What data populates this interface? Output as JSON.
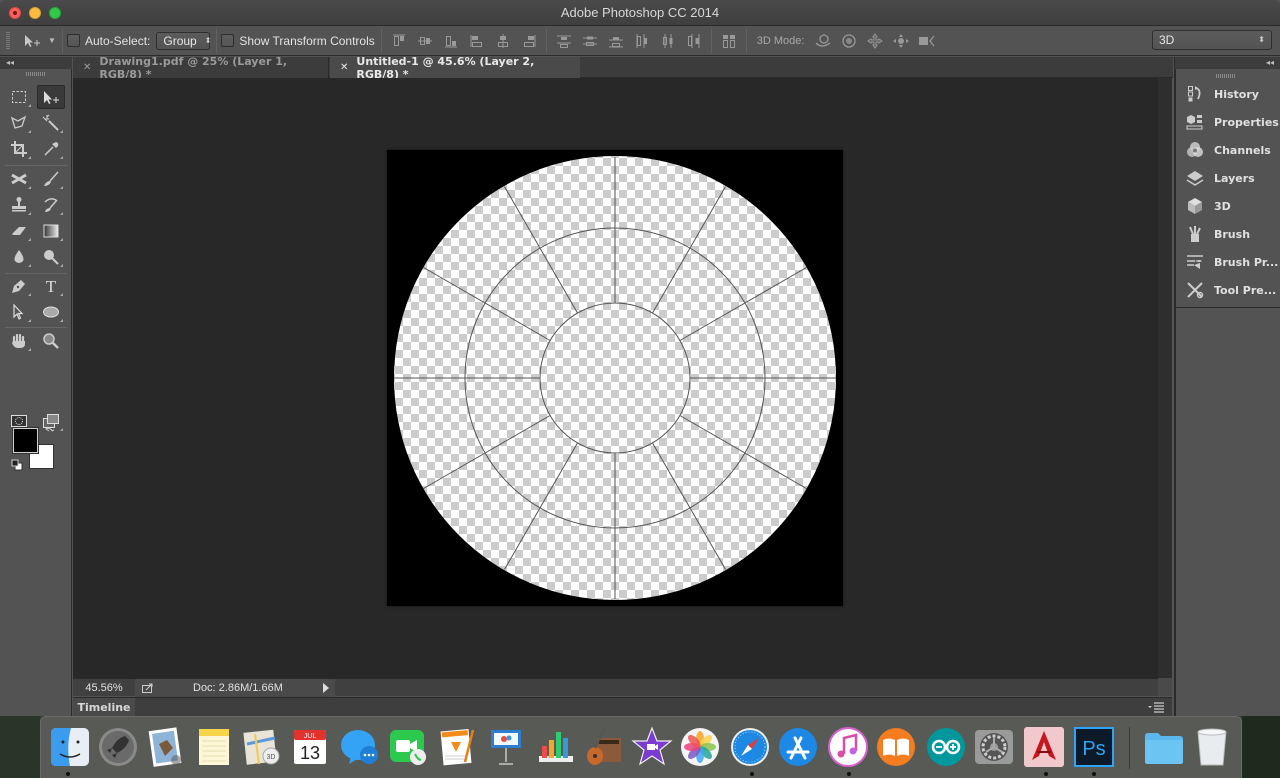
{
  "window": {
    "title": "Adobe Photoshop CC 2014"
  },
  "options_bar": {
    "tool_icon": "move-tool-icon",
    "auto_select_label": "Auto-Select:",
    "auto_select_checked": false,
    "auto_select_mode": "Group",
    "show_transform_label": "Show Transform Controls",
    "show_transform_checked": false,
    "align_buttons": [
      "align-top-edges",
      "align-vertical-centers",
      "align-bottom-edges",
      "align-left-edges",
      "align-horizontal-centers",
      "align-right-edges"
    ],
    "distribute_buttons": [
      "distribute-top-edges",
      "distribute-vertical-centers",
      "distribute-bottom-edges",
      "distribute-left-edges",
      "distribute-horizontal-centers",
      "distribute-right-edges"
    ],
    "auto_align_button": "auto-align-layers",
    "mode_label": "3D Mode:",
    "mode_buttons": [
      "rotate-3d",
      "roll-3d",
      "drag-3d",
      "slide-3d",
      "scale-3d"
    ],
    "workspace": "3D"
  },
  "left_collapse": "◂◂",
  "right_collapse": "◂◂",
  "tabs": [
    {
      "label": "Drawing1.pdf @ 25% (Layer 1, RGB/8) *",
      "active": false
    },
    {
      "label": "Untitled-1 @ 45.6% (Layer 2, RGB/8) *",
      "active": true
    }
  ],
  "toolbar": {
    "tools": [
      "rectangular-marquee",
      "move",
      "polygonal-lasso",
      "magic-wand",
      "crop",
      "eyedropper",
      "spot-healing",
      "brush",
      "clone-stamp",
      "history-brush",
      "eraser",
      "gradient",
      "blur",
      "dodge",
      "pen",
      "type",
      "path-selection",
      "ellipse",
      "hand",
      "zoom"
    ],
    "active_tool": "move",
    "foreground_color": "#000000",
    "background_color": "#ffffff"
  },
  "canvas": {
    "background_color": "#000000",
    "rings": 3,
    "spokes": 12
  },
  "status": {
    "zoom": "45.56%",
    "doc_info": "Doc: 2.86M/1.66M"
  },
  "timeline": {
    "label": "Timeline"
  },
  "right_panel": {
    "items": [
      {
        "label": "History",
        "icon": "history-icon"
      },
      {
        "label": "Properties",
        "icon": "properties-icon"
      },
      {
        "label": "Channels",
        "icon": "channels-icon"
      },
      {
        "label": "Layers",
        "icon": "layers-icon"
      },
      {
        "label": "3D",
        "icon": "3d-icon"
      },
      {
        "label": "Brush",
        "icon": "brush-icon"
      },
      {
        "label": "Brush Pr...",
        "icon": "brush-presets-icon"
      },
      {
        "label": "Tool Pre...",
        "icon": "tool-presets-icon"
      }
    ]
  },
  "dock": {
    "apps": [
      {
        "name": "Finder",
        "running": true
      },
      {
        "name": "Launchpad",
        "running": false
      },
      {
        "name": "Mail",
        "running": false
      },
      {
        "name": "Notes",
        "running": false
      },
      {
        "name": "Maps",
        "running": false
      },
      {
        "name": "Calendar",
        "running": false,
        "month": "JUL",
        "day": "13"
      },
      {
        "name": "Messages",
        "running": false
      },
      {
        "name": "FaceTime",
        "running": false
      },
      {
        "name": "Pages",
        "running": false
      },
      {
        "name": "Keynote",
        "running": false
      },
      {
        "name": "Numbers",
        "running": false
      },
      {
        "name": "GarageBand",
        "running": false
      },
      {
        "name": "iMovie",
        "running": false
      },
      {
        "name": "Photos",
        "running": false
      },
      {
        "name": "Safari",
        "running": true
      },
      {
        "name": "App Store",
        "running": false
      },
      {
        "name": "iTunes",
        "running": true
      },
      {
        "name": "iBooks",
        "running": false
      },
      {
        "name": "Arduino",
        "running": false
      },
      {
        "name": "System Preferences",
        "running": false
      },
      {
        "name": "AutoCAD",
        "running": true
      },
      {
        "name": "Photoshop",
        "running": true
      }
    ],
    "stacks": [
      {
        "name": "Documents Folder"
      },
      {
        "name": "Trash"
      }
    ],
    "ps_label": "Ps"
  }
}
